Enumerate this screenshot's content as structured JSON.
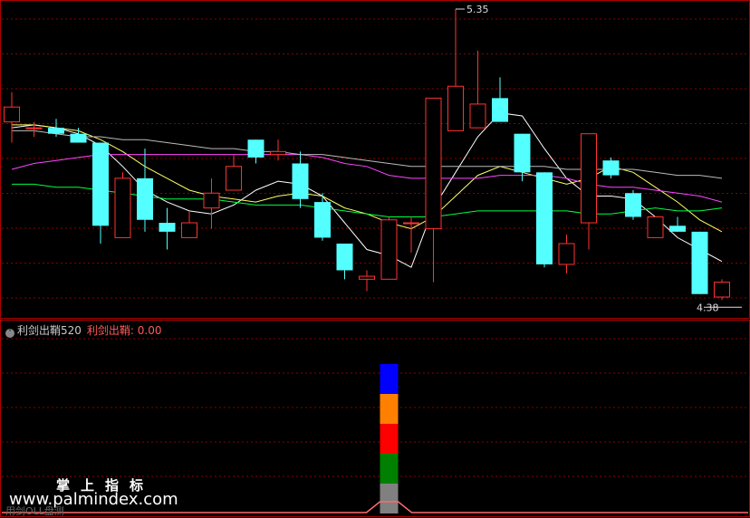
{
  "chart_data": {
    "type": "candlestick",
    "price_range": [
      4.2,
      5.4
    ],
    "high_label": "5.35",
    "low_label": "4.38",
    "candles": [
      {
        "o": 4.97,
        "h": 5.07,
        "l": 4.9,
        "c": 5.02
      },
      {
        "o": 4.95,
        "h": 4.97,
        "l": 4.92,
        "c": 4.95
      },
      {
        "o": 4.95,
        "h": 4.98,
        "l": 4.92,
        "c": 4.93
      },
      {
        "o": 4.93,
        "h": 4.95,
        "l": 4.9,
        "c": 4.9
      },
      {
        "o": 4.9,
        "h": 4.9,
        "l": 4.56,
        "c": 4.62
      },
      {
        "o": 4.58,
        "h": 4.8,
        "l": 4.58,
        "c": 4.78
      },
      {
        "o": 4.78,
        "h": 4.88,
        "l": 4.6,
        "c": 4.64
      },
      {
        "o": 4.63,
        "h": 4.68,
        "l": 4.54,
        "c": 4.6
      },
      {
        "o": 4.58,
        "h": 4.67,
        "l": 4.58,
        "c": 4.63
      },
      {
        "o": 4.68,
        "h": 4.78,
        "l": 4.61,
        "c": 4.73
      },
      {
        "o": 4.74,
        "h": 4.86,
        "l": 4.74,
        "c": 4.82
      },
      {
        "o": 4.91,
        "h": 4.91,
        "l": 4.83,
        "c": 4.85
      },
      {
        "o": 4.86,
        "h": 4.91,
        "l": 4.84,
        "c": 4.87
      },
      {
        "o": 4.83,
        "h": 4.87,
        "l": 4.68,
        "c": 4.71
      },
      {
        "o": 4.7,
        "h": 4.73,
        "l": 4.57,
        "c": 4.58
      },
      {
        "o": 4.56,
        "h": 4.56,
        "l": 4.44,
        "c": 4.47
      },
      {
        "o": 4.44,
        "h": 4.47,
        "l": 4.4,
        "c": 4.45
      },
      {
        "o": 4.44,
        "h": 4.65,
        "l": 4.44,
        "c": 4.64
      },
      {
        "o": 4.63,
        "h": 4.65,
        "l": 4.53,
        "c": 4.63
      },
      {
        "o": 4.61,
        "h": 5.05,
        "l": 4.43,
        "c": 5.05
      },
      {
        "o": 4.94,
        "h": 5.35,
        "l": 4.94,
        "c": 5.09
      },
      {
        "o": 4.95,
        "h": 5.21,
        "l": 4.95,
        "c": 5.03
      },
      {
        "o": 5.05,
        "h": 5.12,
        "l": 4.99,
        "c": 4.97
      },
      {
        "o": 4.93,
        "h": 4.93,
        "l": 4.77,
        "c": 4.8
      },
      {
        "o": 4.8,
        "h": 4.8,
        "l": 4.48,
        "c": 4.49
      },
      {
        "o": 4.49,
        "h": 4.59,
        "l": 4.46,
        "c": 4.56
      },
      {
        "o": 4.63,
        "h": 4.93,
        "l": 4.54,
        "c": 4.93
      },
      {
        "o": 4.84,
        "h": 4.85,
        "l": 4.78,
        "c": 4.79
      },
      {
        "o": 4.73,
        "h": 4.74,
        "l": 4.64,
        "c": 4.65
      },
      {
        "o": 4.58,
        "h": 4.65,
        "l": 4.58,
        "c": 4.65
      },
      {
        "o": 4.62,
        "h": 4.65,
        "l": 4.6,
        "c": 4.6
      },
      {
        "o": 4.6,
        "h": 4.6,
        "l": 4.39,
        "c": 4.39
      },
      {
        "o": 4.38,
        "h": 4.44,
        "l": 4.37,
        "c": 4.43
      }
    ],
    "ma_lines": [
      {
        "color": "#ffffff",
        "values": [
          4.95,
          4.96,
          4.95,
          4.93,
          4.89,
          4.82,
          4.74,
          4.7,
          4.67,
          4.66,
          4.69,
          4.74,
          4.77,
          4.76,
          4.72,
          4.63,
          4.54,
          4.52,
          4.48,
          4.68,
          4.8,
          4.92,
          5.0,
          4.99,
          4.88,
          4.78,
          4.72,
          4.72,
          4.71,
          4.65,
          4.58,
          4.54,
          4.5
        ]
      },
      {
        "color": "#ffff66",
        "values": [
          4.96,
          4.96,
          4.95,
          4.94,
          4.91,
          4.87,
          4.82,
          4.78,
          4.74,
          4.72,
          4.71,
          4.7,
          4.72,
          4.73,
          4.72,
          4.68,
          4.66,
          4.63,
          4.61,
          4.65,
          4.72,
          4.79,
          4.82,
          4.8,
          4.78,
          4.76,
          4.78,
          4.82,
          4.8,
          4.75,
          4.7,
          4.64,
          4.6
        ]
      },
      {
        "color": "#ff44ff",
        "values": [
          4.81,
          4.83,
          4.84,
          4.85,
          4.86,
          4.86,
          4.86,
          4.86,
          4.86,
          4.86,
          4.86,
          4.86,
          4.86,
          4.86,
          4.85,
          4.83,
          4.82,
          4.79,
          4.78,
          4.78,
          4.78,
          4.78,
          4.79,
          4.79,
          4.79,
          4.78,
          4.76,
          4.75,
          4.75,
          4.74,
          4.73,
          4.72,
          4.7
        ]
      },
      {
        "color": "#00ff44",
        "values": [
          4.76,
          4.76,
          4.75,
          4.75,
          4.74,
          4.73,
          4.72,
          4.71,
          4.71,
          4.71,
          4.7,
          4.69,
          4.69,
          4.69,
          4.68,
          4.67,
          4.66,
          4.65,
          4.65,
          4.65,
          4.66,
          4.67,
          4.67,
          4.67,
          4.67,
          4.67,
          4.66,
          4.66,
          4.67,
          4.68,
          4.67,
          4.67,
          4.68
        ]
      },
      {
        "color": "#bbbbbb",
        "values": [
          4.94,
          4.94,
          4.93,
          4.92,
          4.92,
          4.91,
          4.91,
          4.9,
          4.89,
          4.88,
          4.88,
          4.87,
          4.87,
          4.86,
          4.86,
          4.85,
          4.84,
          4.83,
          4.82,
          4.82,
          4.82,
          4.82,
          4.82,
          4.82,
          4.82,
          4.81,
          4.81,
          4.81,
          4.81,
          4.8,
          4.79,
          4.79,
          4.78
        ]
      }
    ],
    "indicator": {
      "name": "利剑出鞘520",
      "value_label": "利剑出鞘: 0.00",
      "signal_index": 17,
      "stack_colors": [
        "#808080",
        "#008000",
        "#ff0000",
        "#ff8000",
        "#0000ff"
      ]
    }
  },
  "watermark": {
    "cn": "掌上指标",
    "url": "www.palmindex.com",
    "bottom": "用剑OLL盘测"
  }
}
